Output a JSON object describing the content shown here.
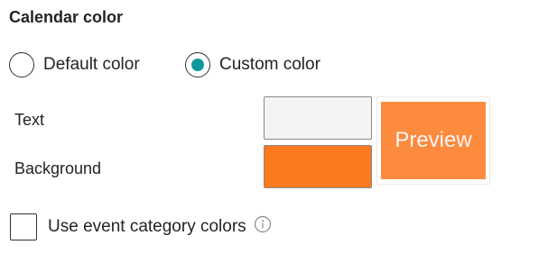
{
  "section": {
    "title": "Calendar color"
  },
  "color_mode": {
    "options": [
      {
        "label": "Default color",
        "selected": false
      },
      {
        "label": "Custom color",
        "selected": true
      }
    ]
  },
  "custom": {
    "text_label": "Text",
    "background_label": "Background",
    "text_color": "#f5f4f4",
    "background_color": "#fb7a1e",
    "preview_label": "Preview",
    "preview_background": "#fd8b3e",
    "preview_text_color": "#f5f4f4"
  },
  "event_category": {
    "label": "Use event category colors",
    "checked": false,
    "info_icon": "info-icon"
  },
  "colors": {
    "accent": "#0e9a9c",
    "border": "#8a8886",
    "text": "#242424"
  }
}
